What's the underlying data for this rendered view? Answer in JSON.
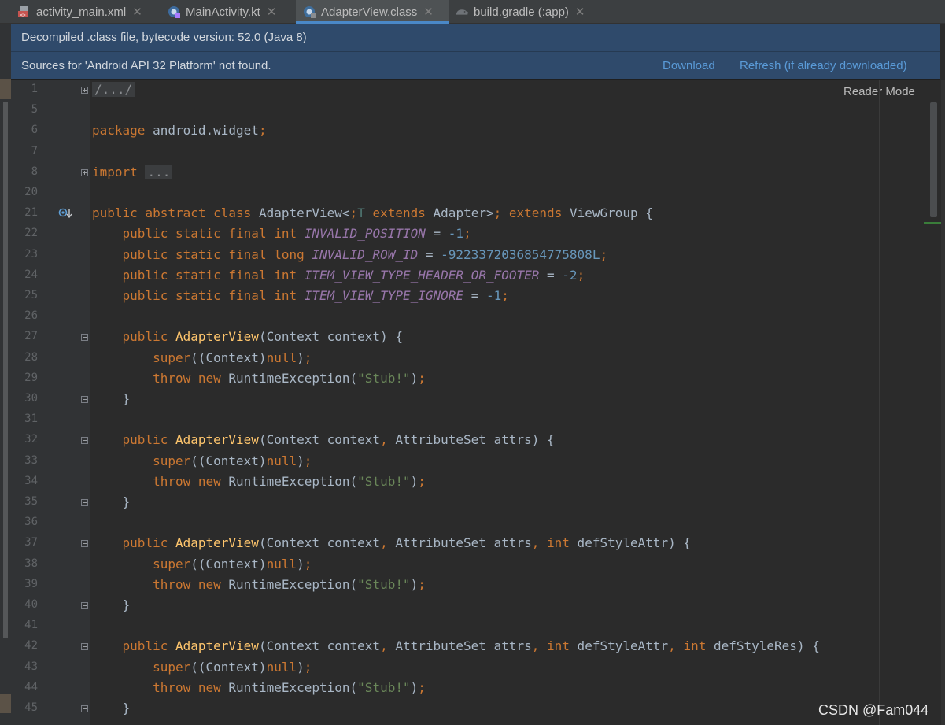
{
  "tabs": [
    {
      "label": "activity_main.xml",
      "icon": "xml-file-icon",
      "active": false
    },
    {
      "label": "MainActivity.kt",
      "icon": "kotlin-file-icon",
      "active": false
    },
    {
      "label": "AdapterView.class",
      "icon": "class-file-icon",
      "active": true
    },
    {
      "label": "build.gradle (:app)",
      "icon": "gradle-icon",
      "active": false
    }
  ],
  "banner_decompiled": "Decompiled .class file, bytecode version: 52.0 (Java 8)",
  "banner_sources": {
    "message": "Sources for 'Android API 32 Platform' not found.",
    "download": "Download",
    "refresh": "Refresh (if already downloaded)"
  },
  "reader_mode": "Reader Mode",
  "watermark": "CSDN @Fam044",
  "colors": {
    "accent": "#4a88c7",
    "banner": "#2f4a6b",
    "link": "#5a9bd8",
    "editor_bg": "#2b2b2b"
  },
  "code": [
    {
      "n": "1",
      "text": "/.../"
    },
    {
      "n": "5",
      "text": ""
    },
    {
      "n": "6",
      "text": "package android.widget;"
    },
    {
      "n": "7",
      "text": ""
    },
    {
      "n": "8",
      "text": "import ..."
    },
    {
      "n": "20",
      "text": ""
    },
    {
      "n": "21",
      "text": "public abstract class AdapterView<T extends Adapter> extends ViewGroup {"
    },
    {
      "n": "22",
      "text": "    public static final int INVALID_POSITION = -1;"
    },
    {
      "n": "23",
      "text": "    public static final long INVALID_ROW_ID = -9223372036854775808L;"
    },
    {
      "n": "24",
      "text": "    public static final int ITEM_VIEW_TYPE_HEADER_OR_FOOTER = -2;"
    },
    {
      "n": "25",
      "text": "    public static final int ITEM_VIEW_TYPE_IGNORE = -1;"
    },
    {
      "n": "26",
      "text": ""
    },
    {
      "n": "27",
      "text": "    public AdapterView(Context context) {"
    },
    {
      "n": "28",
      "text": "        super((Context)null);"
    },
    {
      "n": "29",
      "text": "        throw new RuntimeException(\"Stub!\");"
    },
    {
      "n": "30",
      "text": "    }"
    },
    {
      "n": "31",
      "text": ""
    },
    {
      "n": "32",
      "text": "    public AdapterView(Context context, AttributeSet attrs) {"
    },
    {
      "n": "33",
      "text": "        super((Context)null);"
    },
    {
      "n": "34",
      "text": "        throw new RuntimeException(\"Stub!\");"
    },
    {
      "n": "35",
      "text": "    }"
    },
    {
      "n": "36",
      "text": ""
    },
    {
      "n": "37",
      "text": "    public AdapterView(Context context, AttributeSet attrs, int defStyleAttr) {"
    },
    {
      "n": "38",
      "text": "        super((Context)null);"
    },
    {
      "n": "39",
      "text": "        throw new RuntimeException(\"Stub!\");"
    },
    {
      "n": "40",
      "text": "    }"
    },
    {
      "n": "41",
      "text": ""
    },
    {
      "n": "42",
      "text": "    public AdapterView(Context context, AttributeSet attrs, int defStyleAttr, int defStyleRes) {"
    },
    {
      "n": "43",
      "text": "        super((Context)null);"
    },
    {
      "n": "44",
      "text": "        throw new RuntimeException(\"Stub!\");"
    },
    {
      "n": "45",
      "text": "    }"
    }
  ]
}
